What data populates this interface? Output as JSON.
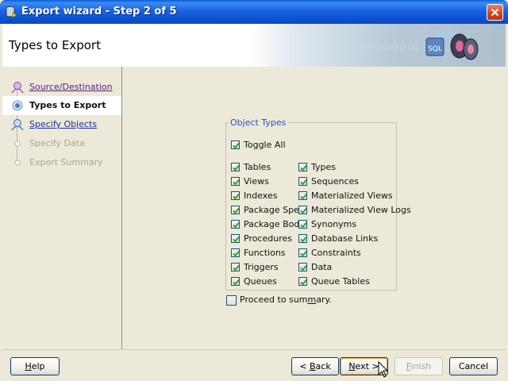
{
  "window": {
    "title": "Export wizard - Step 2 of 5",
    "close_icon": "close-x-icon",
    "app_icon": "database-icon"
  },
  "banner": {
    "title": "Types to Export",
    "bits_text": "0101010101010101010101",
    "art_icon": "database-export-icon",
    "art_text": "SQL"
  },
  "steps": [
    {
      "label": "Source/Destination",
      "state": "visited"
    },
    {
      "label": "Types to Export",
      "state": "current"
    },
    {
      "label": "Specify Objects",
      "state": "link"
    },
    {
      "label": "Specify Data",
      "state": "disabled"
    },
    {
      "label": "Export Summary",
      "state": "disabled"
    }
  ],
  "object_types": {
    "legend": "Object Types",
    "toggle_all": {
      "label": "Toggle All",
      "checked": true
    },
    "left_column": [
      {
        "label": "Tables",
        "checked": true
      },
      {
        "label": "Views",
        "checked": true
      },
      {
        "label": "Indexes",
        "checked": true
      },
      {
        "label": "Package Spec",
        "checked": true
      },
      {
        "label": "Package Body",
        "checked": true
      },
      {
        "label": "Procedures",
        "checked": true
      },
      {
        "label": "Functions",
        "checked": true
      },
      {
        "label": "Triggers",
        "checked": true
      },
      {
        "label": "Queues",
        "checked": true
      }
    ],
    "right_column": [
      {
        "label": "Types",
        "checked": true
      },
      {
        "label": "Sequences",
        "checked": true
      },
      {
        "label": "Materialized Views",
        "checked": true
      },
      {
        "label": "Materialized View Logs",
        "checked": true
      },
      {
        "label": "Synonyms",
        "checked": true
      },
      {
        "label": "Database Links",
        "checked": true
      },
      {
        "label": "Constraints",
        "checked": true
      },
      {
        "label": "Data",
        "checked": true
      },
      {
        "label": "Queue Tables",
        "checked": true
      }
    ]
  },
  "proceed_to_summary": {
    "label_before": "Proceed to sum",
    "label_mnemonic": "m",
    "label_after": "ary.",
    "checked": false
  },
  "buttons": {
    "help": {
      "mnemonic": "H",
      "rest": "elp"
    },
    "back": {
      "prefix": "< ",
      "mnemonic": "B",
      "rest": "ack"
    },
    "next": {
      "mnemonic": "N",
      "rest": "ext >"
    },
    "finish": {
      "mnemonic": "F",
      "rest": "inish"
    },
    "cancel": {
      "label": "Cancel"
    }
  },
  "colors": {
    "title_bar": "#1a63e0",
    "link": "#1c2fa0",
    "visited_link": "#5a2080",
    "legend": "#2454c5",
    "disabled_text": "#a8a59a"
  }
}
